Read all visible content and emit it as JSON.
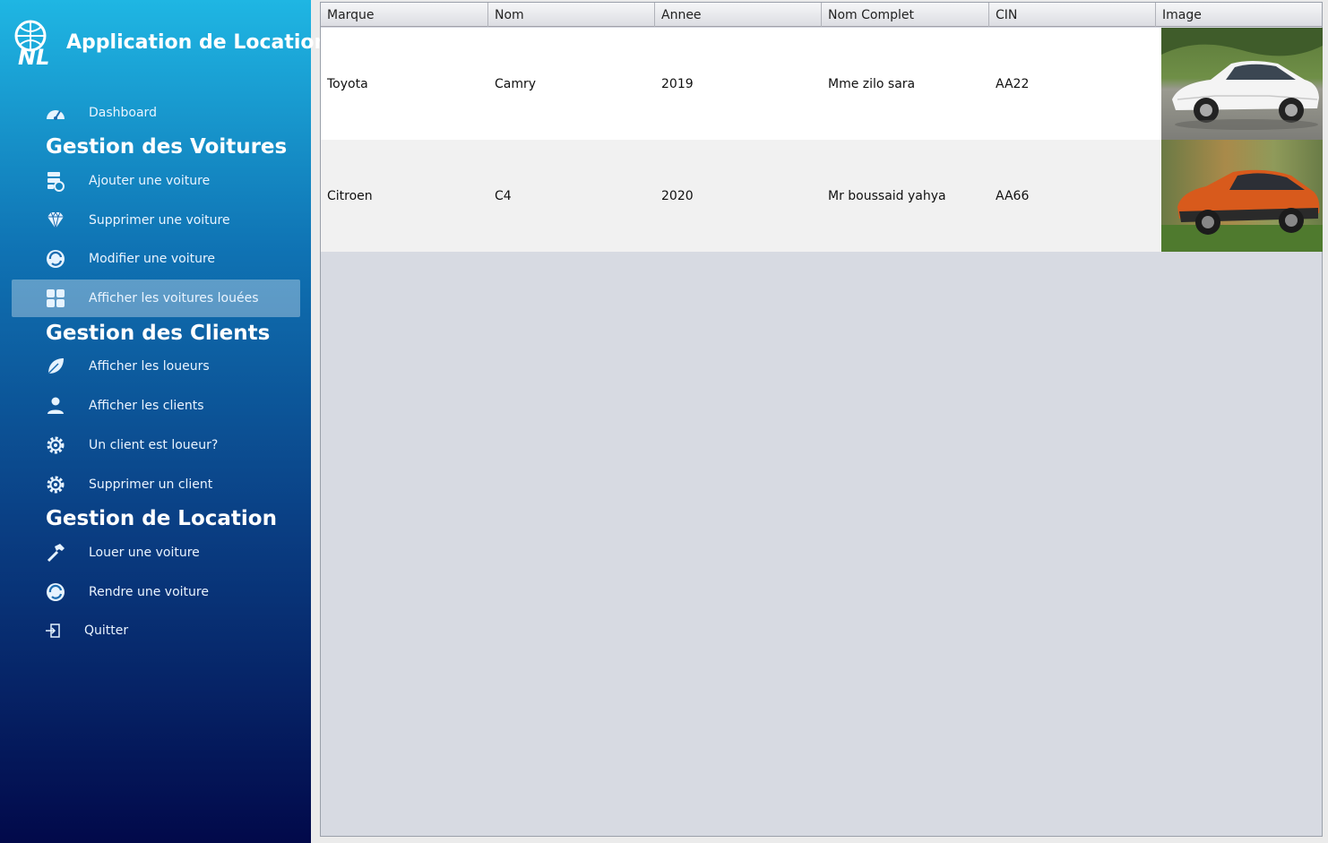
{
  "app": {
    "title": "Application de Location"
  },
  "sidebar": {
    "dashboard": "Dashboard",
    "sections": {
      "voitures": "Gestion des Voitures",
      "clients": "Gestion des Clients",
      "location": "Gestion de Location"
    },
    "items": {
      "ajouter_voiture": "Ajouter une voiture",
      "supprimer_voiture": "Supprimer une voiture",
      "modifier_voiture": "Modifier une voiture",
      "afficher_louees": "Afficher les voitures louées",
      "afficher_loueurs": "Afficher les loueurs",
      "afficher_clients": "Afficher les clients",
      "client_loueur": "Un client est loueur?",
      "supprimer_client": "Supprimer un client",
      "louer_voiture": "Louer une voiture",
      "rendre_voiture": "Rendre une voiture",
      "quitter": "Quitter"
    },
    "active_item": "afficher_louees"
  },
  "table": {
    "columns": [
      "Marque",
      "Nom",
      "Annee",
      "Nom Complet",
      "CIN",
      "Image"
    ],
    "rows": [
      {
        "marque": "Toyota",
        "nom": "Camry",
        "annee": "2019",
        "nom_complet": "Mme zilo sara",
        "cin": "AA22",
        "image": "white-sedan-photo"
      },
      {
        "marque": "Citroen",
        "nom": "C4",
        "annee": "2020",
        "nom_complet": "Mr boussaid yahya",
        "cin": "AA66",
        "image": "orange-suv-photo"
      }
    ]
  },
  "colors": {
    "sidebar_top": "#1fb6e3",
    "sidebar_bottom": "#02094a",
    "table_bg": "#d7dae2",
    "active_item": "rgba(255,255,255,0.33)"
  }
}
